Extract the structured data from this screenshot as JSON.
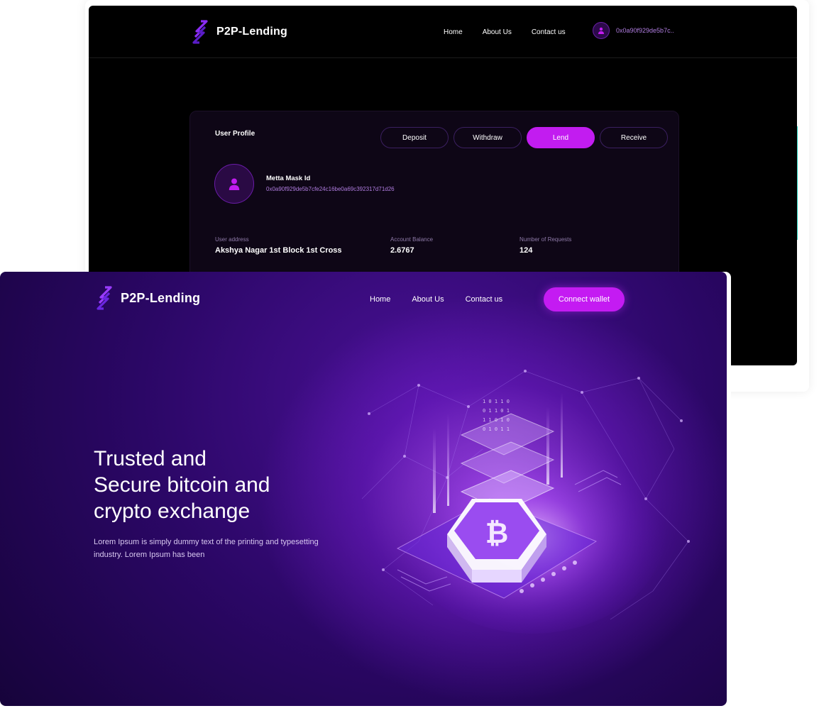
{
  "dashboard": {
    "brand": "P2P-Lending",
    "nav": [
      "Home",
      "About Us",
      "Contact us"
    ],
    "user_address_short": "0x0a90f929de5b7c..",
    "profile": {
      "title": "User Profile",
      "tabs": [
        "Deposit",
        "Withdraw",
        "Lend",
        "Receive"
      ],
      "active_tab": "Lend",
      "wallet_label": "Metta Mask Id",
      "wallet_id": "0x0a90f929de5b7cfe24c16be0a69c392317d71d26",
      "stats": [
        {
          "label": "User address",
          "value": "Akshya Nagar 1st Block 1st Cross"
        },
        {
          "label": "Account Balance",
          "value": "2.6767"
        },
        {
          "label": "Number of Requests",
          "value": "124"
        }
      ]
    }
  },
  "landing": {
    "brand": "P2P-Lending",
    "nav": [
      "Home",
      "About Us",
      "Contact us"
    ],
    "connect_label": "Connect wallet",
    "hero_title_lines": [
      "Trusted and",
      "Secure bitcoin and",
      "crypto exchange"
    ],
    "hero_sub": "Lorem Ipsum is simply dummy text of the printing and typesetting industry. Lorem Ipsum has been",
    "illustration_icon": "bitcoin-icon"
  },
  "colors": {
    "accent": "#c21cf0",
    "bg_dark": "#000000",
    "card": "#0e0616",
    "purple_text": "#b07de0",
    "teal": "#2bd4c0"
  }
}
